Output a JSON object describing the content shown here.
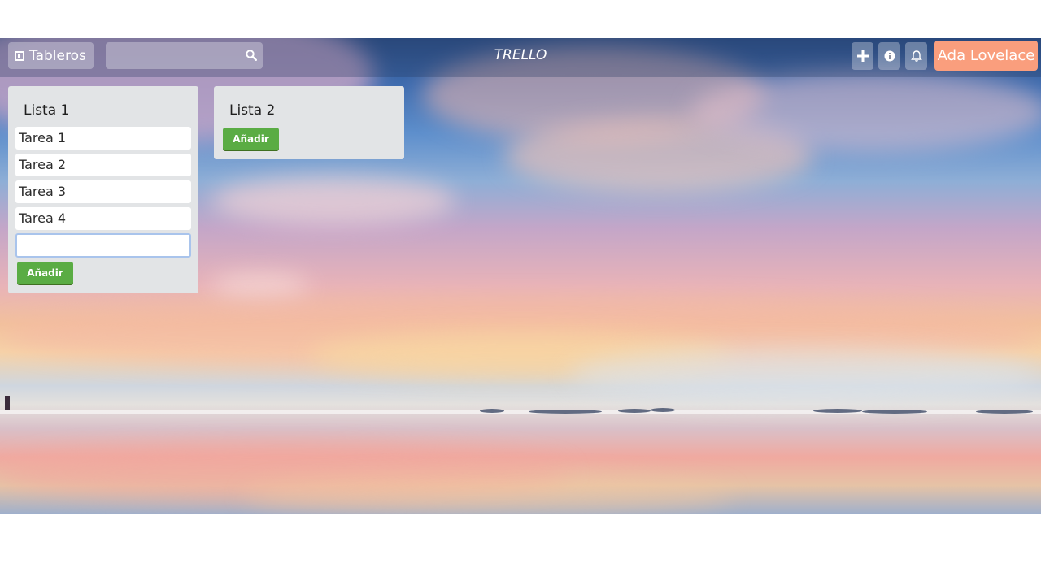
{
  "header": {
    "boards_label": "Tableros",
    "search_placeholder": "",
    "brand": "TRELLO",
    "user_name": "Ada Lovelace"
  },
  "lists": [
    {
      "title": "Lista 1",
      "cards": [
        "Tarea 1",
        "Tarea 2",
        "Tarea 3",
        "Tarea 4"
      ],
      "input_value": "",
      "add_label": "Añadir"
    },
    {
      "title": "Lista 2",
      "cards": [],
      "add_label": "Añadir"
    }
  ],
  "colors": {
    "add_button": "#5aac44",
    "user_badge": "#fa9e7d",
    "list_bg": "#e2e4e6"
  },
  "icons": [
    "board-icon",
    "search-icon",
    "plus-icon",
    "info-icon",
    "bell-icon"
  ]
}
